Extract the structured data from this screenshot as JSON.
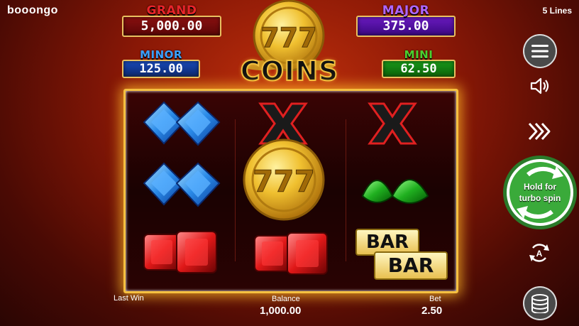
{
  "brand": "booongo",
  "lines": "5 Lines",
  "jackpots": {
    "grand": {
      "label": "GRAND",
      "value": "5,000.00"
    },
    "major": {
      "label": "MAJOR",
      "value": "375.00"
    },
    "minor": {
      "label": "MINOR",
      "value": "125.00"
    },
    "mini": {
      "label": "MINI",
      "value": "62.50"
    }
  },
  "logo": {
    "coin_text": "777",
    "title": "COINS"
  },
  "reels": [
    [
      "blue-diamond",
      "blue-diamond",
      "red-ruby"
    ],
    [
      "x-symbol",
      "gold-777-coin",
      "gold-777-coin",
      "red-ruby"
    ],
    [
      "x-symbol",
      "green-emerald",
      "bar-bar"
    ]
  ],
  "symbols": {
    "coin_text": "777",
    "bar_text": "BAR"
  },
  "footer": {
    "last_win_label": "Last Win",
    "balance_label": "Balance",
    "balance_value": "1,000.00",
    "bet_label": "Bet",
    "bet_value": "2.50"
  },
  "controls": {
    "turbo_line1": "Hold for",
    "turbo_line2": "turbo spin",
    "auto_letter": "A"
  },
  "colors": {
    "frame": "#f5c040",
    "turbo": "#3aaa3a",
    "grand": "#e8242a",
    "major": "#b066ff",
    "minor": "#3aa0ff",
    "mini": "#4ad030"
  }
}
